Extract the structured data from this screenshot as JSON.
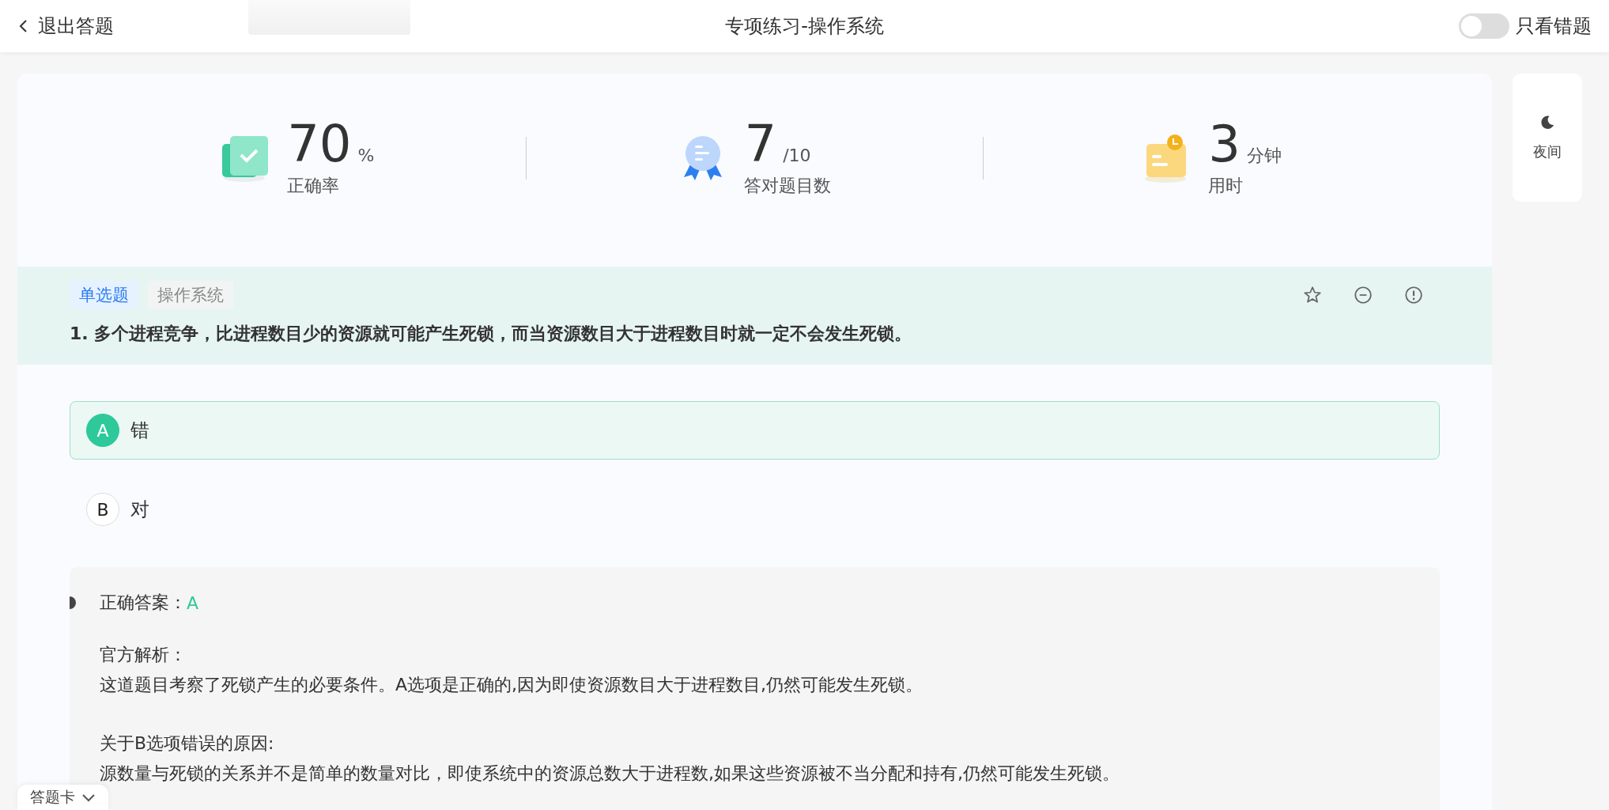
{
  "header": {
    "back_label": "退出答题",
    "title": "专项练习-操作系统",
    "toggle": {
      "label": "只看错题",
      "on": false
    }
  },
  "stats": [
    {
      "kind": "accuracy",
      "value": "70",
      "unit": "%",
      "label": "正确率"
    },
    {
      "kind": "correct",
      "value": "7",
      "unit": "/10",
      "label": "答对题目数"
    },
    {
      "kind": "time",
      "value": "3",
      "unit": "分钟",
      "label": "用时"
    }
  ],
  "night_button": {
    "label": "夜间"
  },
  "question": {
    "tags": [
      {
        "kind": "type",
        "label": "单选题"
      },
      {
        "kind": "subject",
        "label": "操作系统"
      }
    ],
    "text": "1. 多个进程竞争，比进程数目少的资源就可能产生死锁，而当资源数目大于进程数目时就一定不会发生死锁。",
    "options": [
      {
        "letter": "A",
        "text": "错",
        "selected": true
      },
      {
        "letter": "B",
        "text": "对",
        "selected": false
      }
    ]
  },
  "explanation": {
    "answer_label": "正确答案：",
    "answer": "A",
    "analysis_title": "官方解析：",
    "paragraphs": [
      {
        "kind": "body",
        "text": "这道题目考察了死锁产生的必要条件。A选项是正确的,因为即使资源数目大于进程数目,仍然可能发生死锁。"
      },
      {
        "kind": "heading",
        "text": "关于B选项错误的原因:"
      },
      {
        "kind": "body",
        "text": "源数量与死锁的关系并不是简单的数量对比，即使系统中的资源总数大于进程数,如果这些资源被不当分配和持有,仍然可能发生死锁。"
      }
    ]
  },
  "answer_card": {
    "label": "答题卡"
  }
}
